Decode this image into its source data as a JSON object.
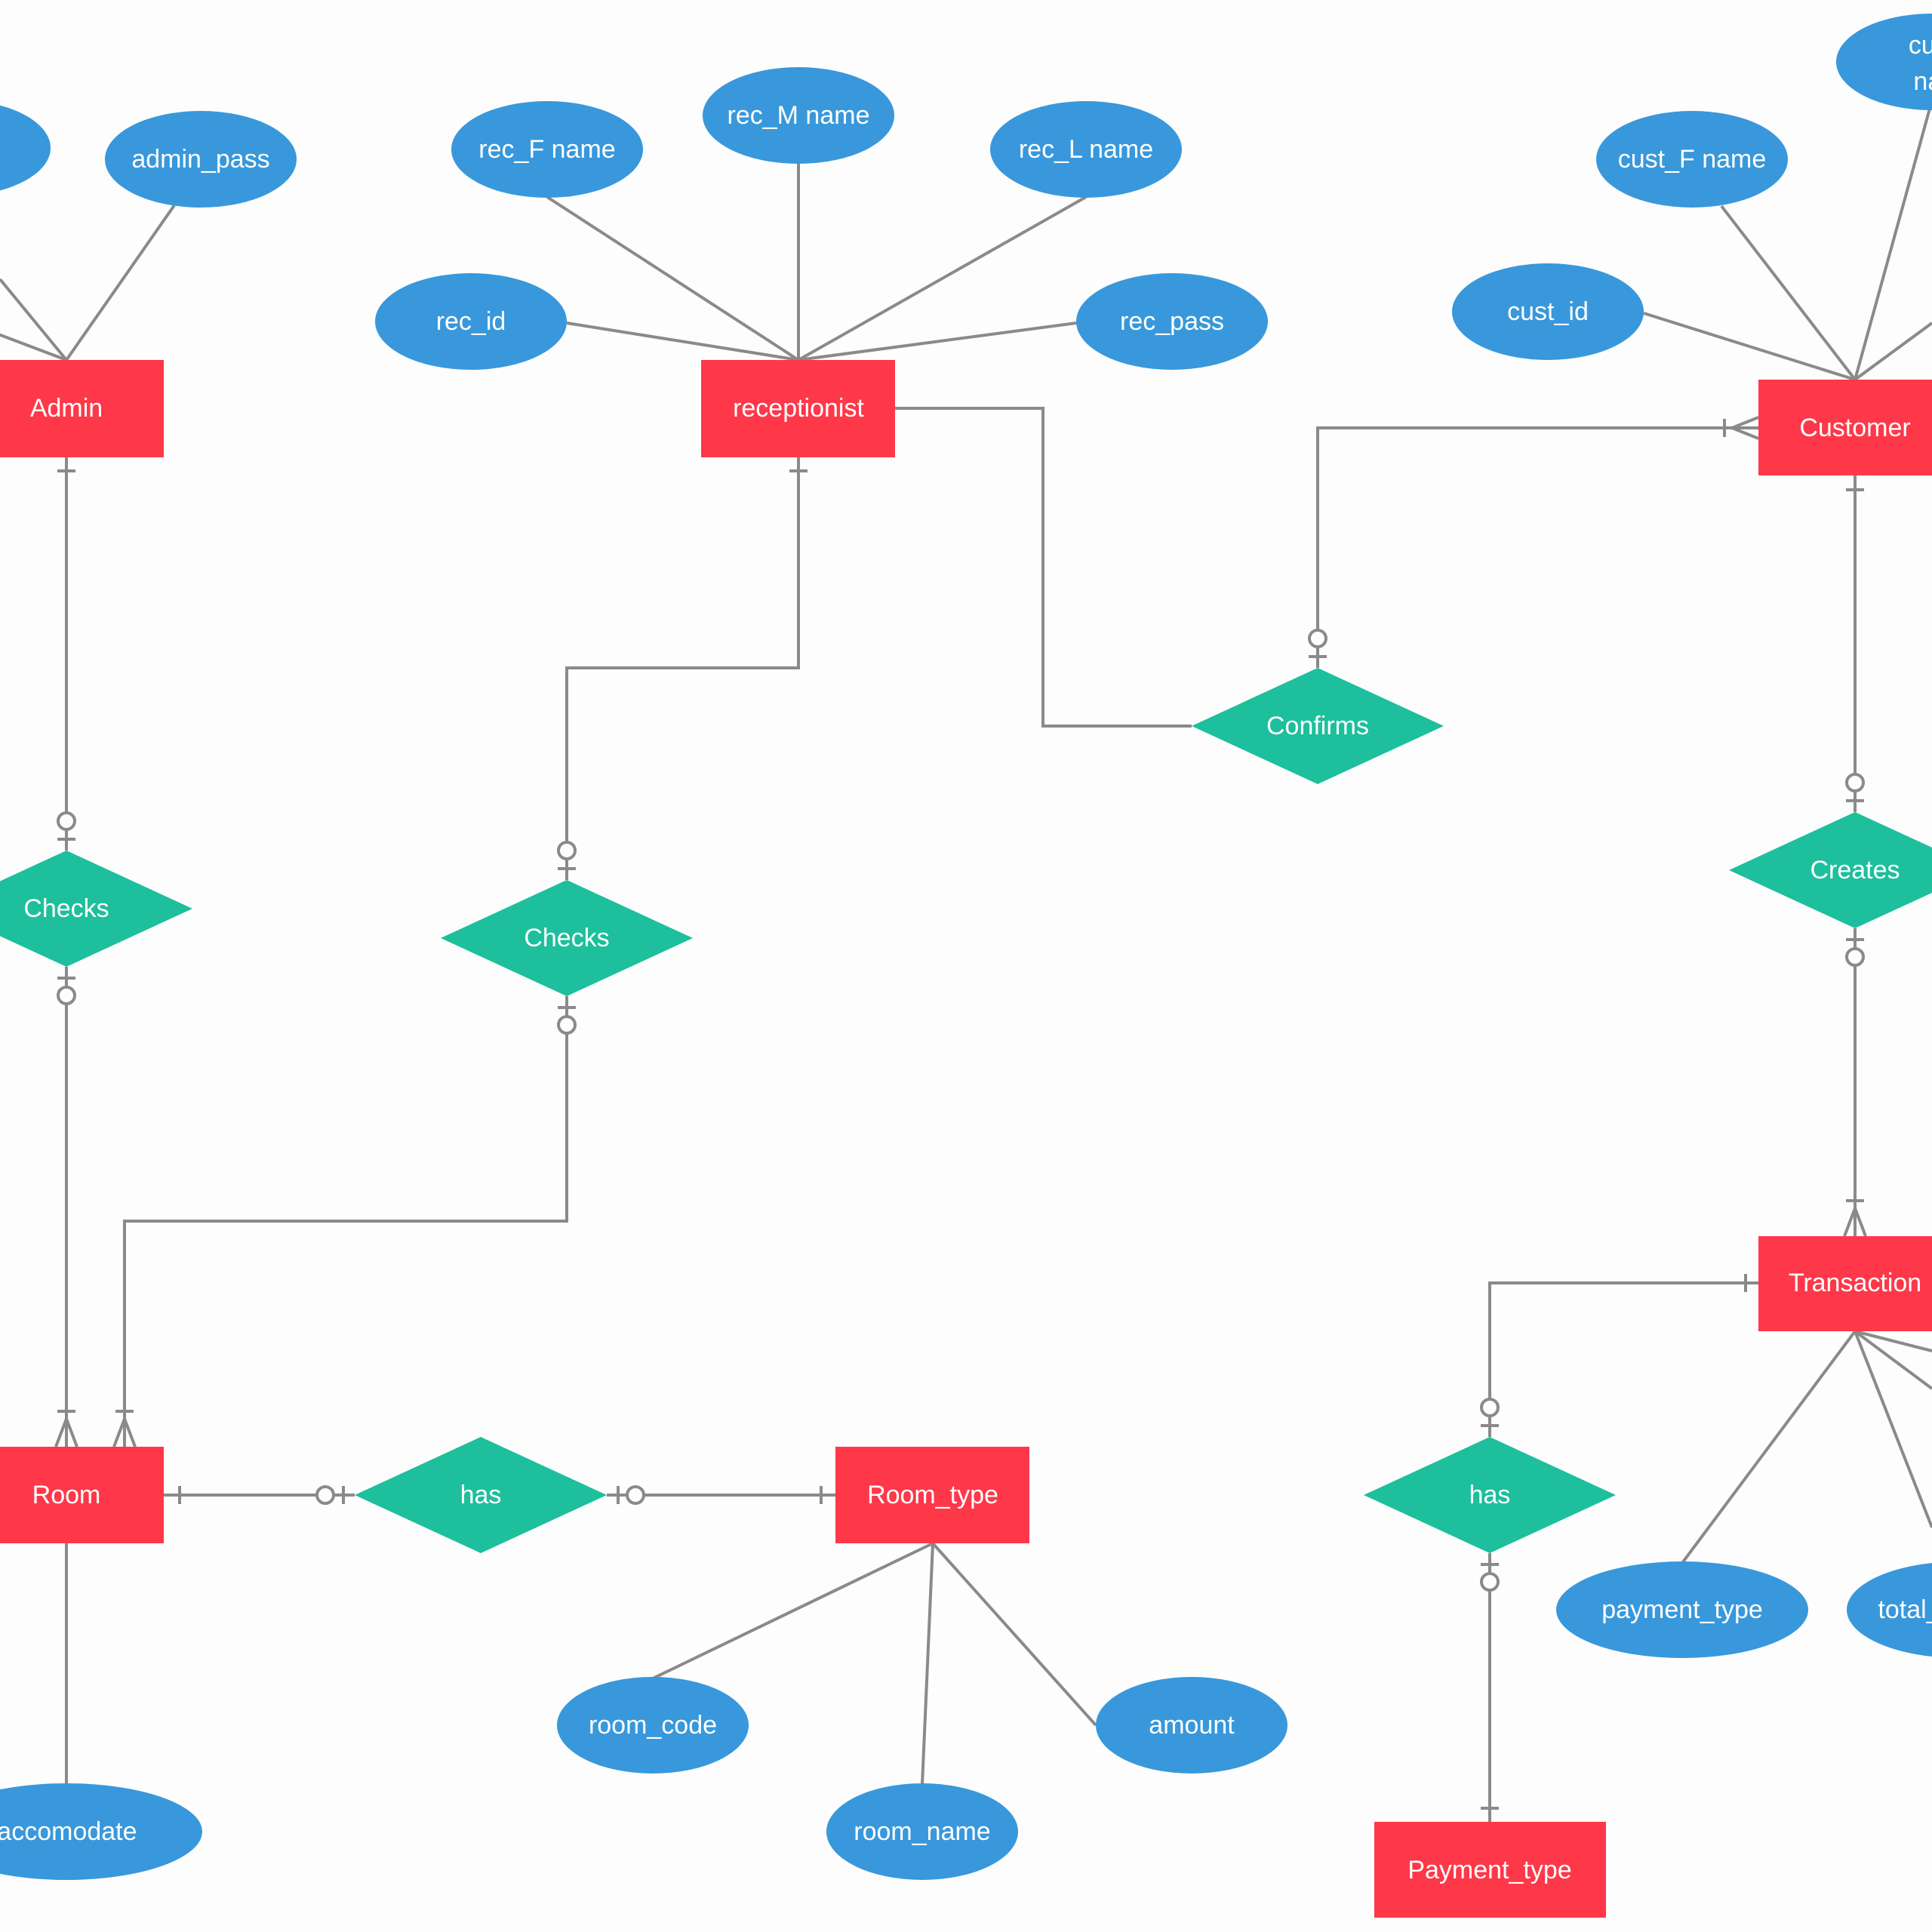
{
  "diagram": {
    "type": "entity-relationship",
    "colors": {
      "entity": "#fe3849",
      "relationship": "#1dbf9c",
      "attribute": "#3898db",
      "connector": "#8a8a8a",
      "text": "#ffffff",
      "background": "#fdfdfd"
    },
    "entities": [
      {
        "id": "admin",
        "label": "Admin"
      },
      {
        "id": "receptionist",
        "label": "receptionist"
      },
      {
        "id": "customer",
        "label": "Customer"
      },
      {
        "id": "transaction",
        "label": "Transaction"
      },
      {
        "id": "room",
        "label": "Room"
      },
      {
        "id": "room_type",
        "label": "Room_type"
      },
      {
        "id": "payment_type",
        "label": "Payment_type"
      }
    ],
    "relationships": [
      {
        "id": "admin_checks",
        "label": "Checks"
      },
      {
        "id": "rec_checks",
        "label": "Checks"
      },
      {
        "id": "confirms",
        "label": "Confirms"
      },
      {
        "id": "creates",
        "label": "Creates"
      },
      {
        "id": "room_has",
        "label": "has"
      },
      {
        "id": "txn_has",
        "label": "has"
      }
    ],
    "attributes": [
      {
        "id": "admin_left_attr",
        "label": "",
        "entity": "admin"
      },
      {
        "id": "admin_pass",
        "label": "admin_pass",
        "entity": "admin"
      },
      {
        "id": "rec_id",
        "label": "rec_id",
        "entity": "receptionist"
      },
      {
        "id": "rec_f_name",
        "label": "rec_F name",
        "entity": "receptionist"
      },
      {
        "id": "rec_m_name",
        "label": "rec_M name",
        "entity": "receptionist"
      },
      {
        "id": "rec_l_name",
        "label": "rec_L name",
        "entity": "receptionist"
      },
      {
        "id": "rec_pass",
        "label": "rec_pass",
        "entity": "receptionist"
      },
      {
        "id": "cust_id",
        "label": "cust_id",
        "entity": "customer"
      },
      {
        "id": "cust_f_name",
        "label": "cust_F name",
        "entity": "customer"
      },
      {
        "id": "cust_name_partial",
        "label": "cust",
        "label2": "nar",
        "entity": "customer"
      },
      {
        "id": "payment_type_attr",
        "label": "payment_type",
        "entity": "transaction"
      },
      {
        "id": "total_partial",
        "label": "total_",
        "entity": "transaction"
      },
      {
        "id": "room_code",
        "label": "room_code",
        "entity": "room_type"
      },
      {
        "id": "room_name",
        "label": "room_name",
        "entity": "room_type"
      },
      {
        "id": "amount",
        "label": "amount",
        "entity": "room_type"
      },
      {
        "id": "accomodate",
        "label": "o_accomodate",
        "entity": "room"
      }
    ]
  }
}
